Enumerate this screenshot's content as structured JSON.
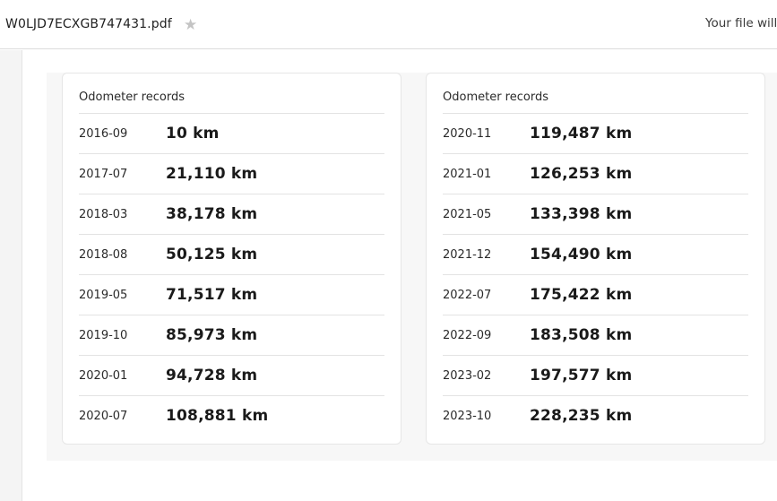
{
  "header": {
    "filename": "W0LJD7ECXGB747431.pdf",
    "star_icon": "★",
    "notice": "Your file will"
  },
  "cards": [
    {
      "title": "Odometer records",
      "rows": [
        {
          "date": "2016-09",
          "value": "10 km"
        },
        {
          "date": "2017-07",
          "value": "21,110 km"
        },
        {
          "date": "2018-03",
          "value": "38,178 km"
        },
        {
          "date": "2018-08",
          "value": "50,125 km"
        },
        {
          "date": "2019-05",
          "value": "71,517 km"
        },
        {
          "date": "2019-10",
          "value": "85,973 km"
        },
        {
          "date": "2020-01",
          "value": "94,728 km"
        },
        {
          "date": "2020-07",
          "value": "108,881 km"
        }
      ]
    },
    {
      "title": "Odometer records",
      "rows": [
        {
          "date": "2020-11",
          "value": "119,487 km"
        },
        {
          "date": "2021-01",
          "value": "126,253 km"
        },
        {
          "date": "2021-05",
          "value": "133,398 km"
        },
        {
          "date": "2021-12",
          "value": "154,490 km"
        },
        {
          "date": "2022-07",
          "value": "175,422 km"
        },
        {
          "date": "2022-09",
          "value": "183,508 km"
        },
        {
          "date": "2023-02",
          "value": "197,577 km"
        },
        {
          "date": "2023-10",
          "value": "228,235 km"
        }
      ]
    }
  ]
}
